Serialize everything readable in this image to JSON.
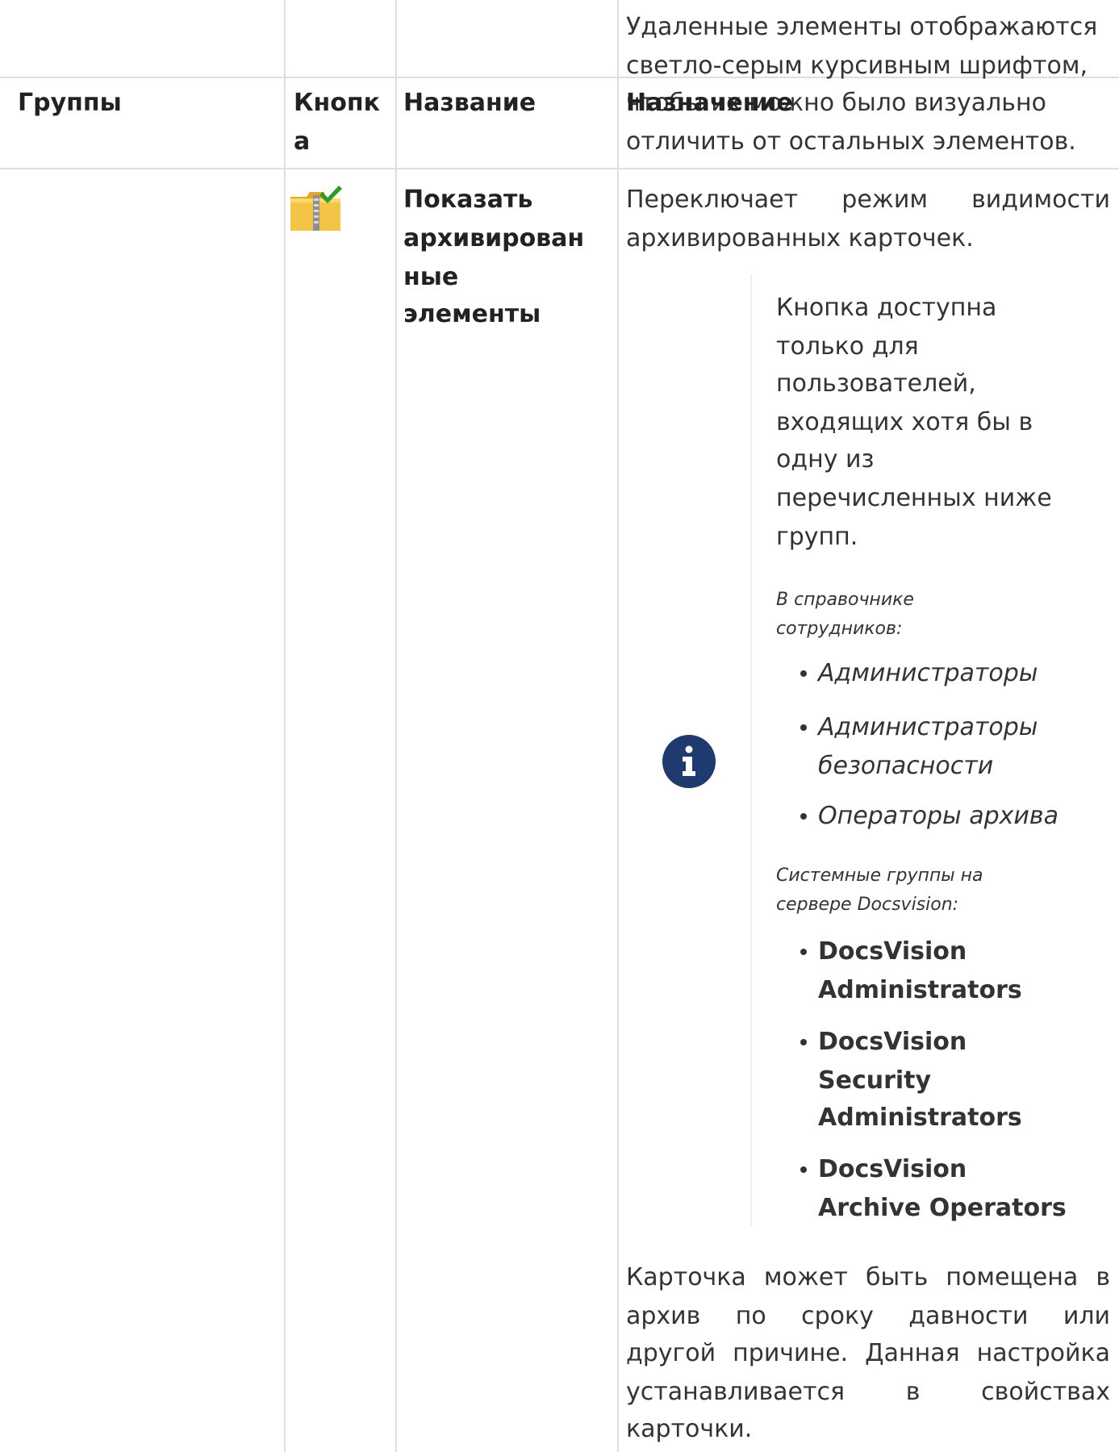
{
  "intro_lines": [
    "Удаленные элементы отображаются",
    "светло-серым курсивным шрифтом,",
    "чтобы их можно было визуально",
    "отличить от остальных элементов."
  ],
  "table": {
    "headers": {
      "groups": "Группы",
      "button_line1": "Кнопк",
      "button_line2": "а",
      "name": "Название",
      "purpose": "Назначение"
    },
    "row": {
      "icon_name": "archive-folder-check-icon",
      "name_lines": [
        "Показать",
        "архивирован",
        "ные",
        "элементы"
      ],
      "purpose_lines": [
        "Переключает режим видимости",
        "архивированных карточек."
      ],
      "note": {
        "icon_name": "info-icon",
        "accent_color": "#1e3a6e",
        "text_lines": [
          "Кнопка доступна",
          "только для",
          "пользователей,",
          "входящих хотя бы в",
          "одну из",
          "перечисленных ниже",
          "групп."
        ],
        "employee_heading_lines": [
          "В справочнике",
          "сотрудников:"
        ],
        "employee_groups": [
          [
            "Администраторы"
          ],
          [
            "Администраторы",
            "безопасности"
          ],
          [
            "Операторы архива"
          ]
        ],
        "system_heading_lines": [
          "Системные группы на",
          "сервере Docsvision:"
        ],
        "system_groups": [
          [
            "DocsVision",
            "Administrators"
          ],
          [
            "DocsVision",
            "Security",
            "Administrators"
          ],
          [
            "DocsVision",
            "Archive Operators"
          ]
        ]
      },
      "footer_lines": [
        "Карточка может быть помещена в",
        "архив по сроку давности или",
        "другой причине. Данная настройка",
        "устанавливается в свойствах",
        "карточки."
      ]
    }
  }
}
